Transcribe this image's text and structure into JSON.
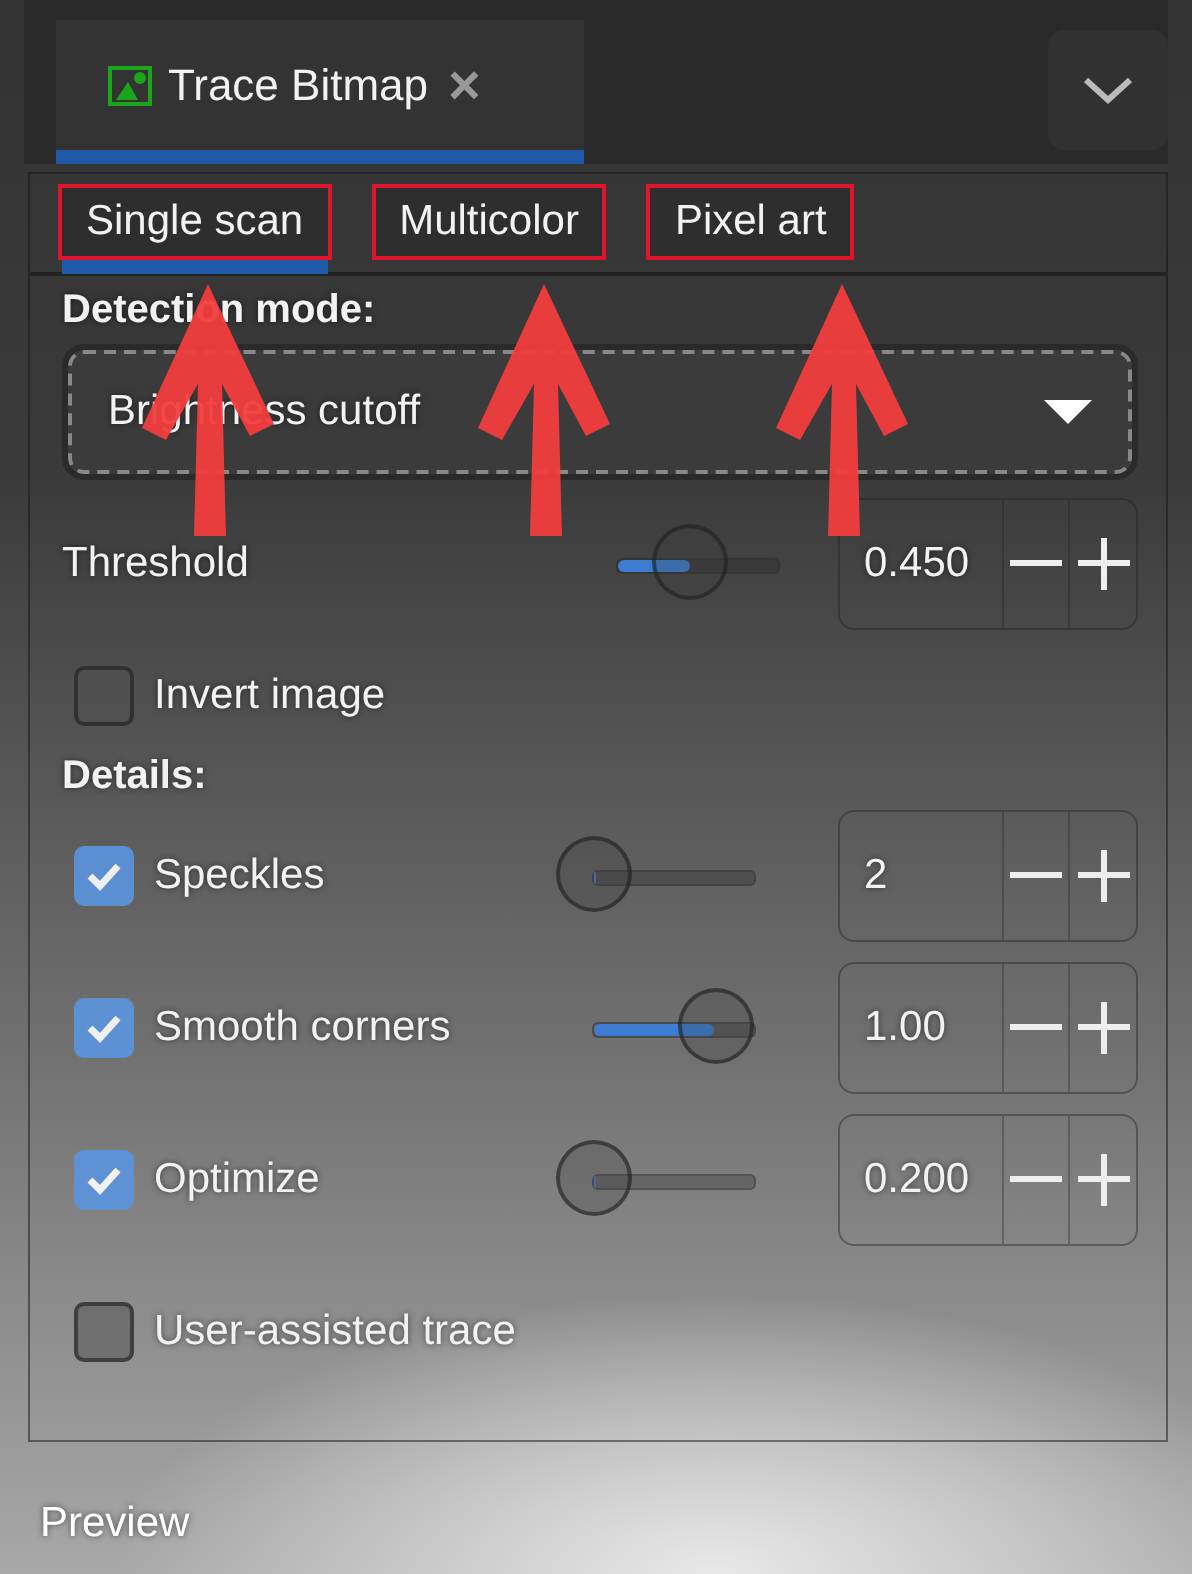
{
  "dock_tab": {
    "title": "Trace Bitmap",
    "selected": true,
    "close": "×"
  },
  "mode_tabs": [
    {
      "label": "Single scan",
      "selected": true
    },
    {
      "label": "Multicolor",
      "selected": false
    },
    {
      "label": "Pixel art",
      "selected": false
    }
  ],
  "detection": {
    "heading": "Detection mode:",
    "value": "Brightness cutoff"
  },
  "threshold": {
    "label": "Threshold",
    "level": 0.45,
    "value": "0.450"
  },
  "invert": {
    "label": "Invert image",
    "checked": false
  },
  "details_heading": "Details:",
  "details": [
    {
      "kind": "slider",
      "label": "Speckles",
      "checked": true,
      "level": 0.01,
      "value": "2"
    },
    {
      "kind": "slider",
      "label": "Smooth corners",
      "checked": true,
      "level": 0.75,
      "value": "1.00"
    },
    {
      "kind": "slider",
      "label": "Optimize",
      "checked": true,
      "level": 0.01,
      "value": "0.200"
    },
    {
      "kind": "check",
      "label": "User-assisted trace",
      "checked": false
    }
  ],
  "preview": "Preview"
}
